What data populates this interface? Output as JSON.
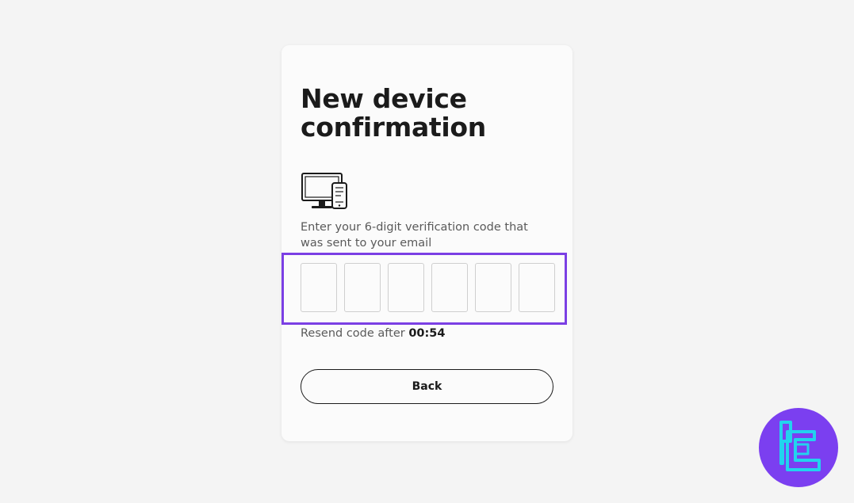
{
  "card": {
    "title": "New device confirmation",
    "instruction": "Enter your 6-digit verification code that was sent to your email",
    "code_boxes": [
      "",
      "",
      "",
      "",
      "",
      ""
    ],
    "resend_label": "Resend code after ",
    "resend_timer": "00:54",
    "back_label": "Back"
  },
  "icons": {
    "device": "desktop-and-phone-icon",
    "logo": "tc-logo-icon"
  },
  "colors": {
    "background": "#f4f4f4",
    "card": "#fbfbfb",
    "highlight": "#7b3fe4",
    "logo_bg": "#7b3ff0",
    "logo_fg": "#22d3ee",
    "text_dark": "#1b1b1b",
    "text_muted": "#5a5a5a"
  }
}
